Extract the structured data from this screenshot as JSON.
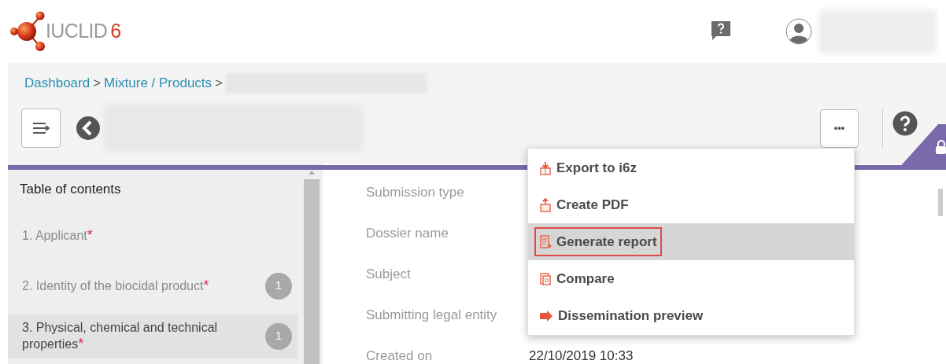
{
  "header": {
    "logo_text": "IUCLID",
    "logo_version": "6"
  },
  "breadcrumb": {
    "items": [
      "Dashboard",
      "Mixture / Products"
    ],
    "separator": ">"
  },
  "toolbar": {
    "more_label": "•••"
  },
  "toc": {
    "title": "Table of contents",
    "required_mark": "*",
    "items": [
      {
        "label": "1. Applicant",
        "required": true,
        "selected": false
      },
      {
        "label": "2. Identity of the biocidal product",
        "required": true,
        "badge": "1",
        "selected": false
      },
      {
        "label": "3. Physical, chemical and technical properties",
        "required": true,
        "badge": "1",
        "selected": true
      }
    ]
  },
  "fields": [
    {
      "label": "Submission type"
    },
    {
      "label": "Dossier name"
    },
    {
      "label": "Subject"
    },
    {
      "label": "Submitting legal entity"
    },
    {
      "label": "Created on",
      "value": "22/10/2019 10:33"
    }
  ],
  "menu": {
    "items": [
      {
        "kind": "export",
        "label": "Export to i6z",
        "selected": false,
        "outlined": false
      },
      {
        "kind": "pdf",
        "label": "Create PDF",
        "selected": false,
        "outlined": false
      },
      {
        "kind": "report",
        "label": "Generate report",
        "selected": true,
        "outlined": true
      },
      {
        "kind": "compare",
        "label": "Compare",
        "selected": false,
        "outlined": false
      },
      {
        "kind": "preview",
        "label": "Dissemination preview",
        "selected": false,
        "outlined": false
      }
    ]
  }
}
